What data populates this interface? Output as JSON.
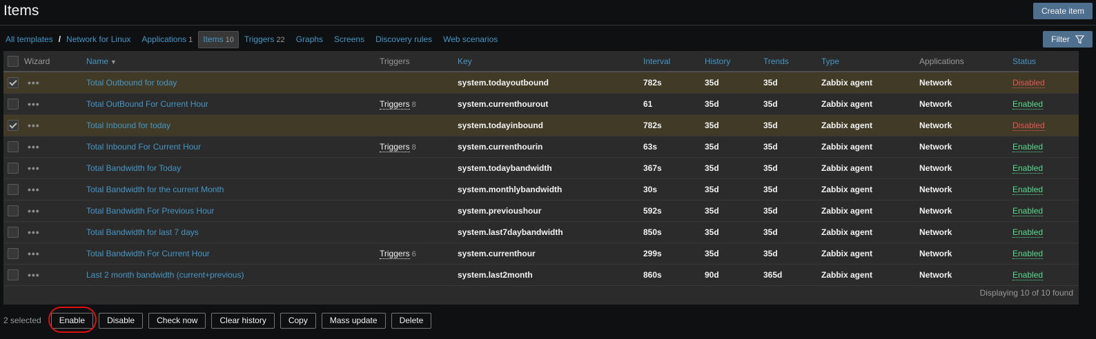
{
  "page": {
    "title": "Items",
    "create_button": "Create item"
  },
  "nav": {
    "breadcrumb_root": "All templates",
    "separator": "/",
    "template": "Network for Linux",
    "tabs": [
      {
        "label": "Applications",
        "count": "1"
      },
      {
        "label": "Items",
        "count": "10"
      },
      {
        "label": "Triggers",
        "count": "22"
      },
      {
        "label": "Graphs",
        "count": ""
      },
      {
        "label": "Screens",
        "count": ""
      },
      {
        "label": "Discovery rules",
        "count": ""
      },
      {
        "label": "Web scenarios",
        "count": ""
      }
    ],
    "active_tab": "Items"
  },
  "filter": {
    "label": "Filter",
    "icon": "funnel-icon"
  },
  "table": {
    "headers": {
      "wizard": "Wizard",
      "name": "Name",
      "triggers": "Triggers",
      "key": "Key",
      "interval": "Interval",
      "history": "History",
      "trends": "Trends",
      "type": "Type",
      "applications": "Applications",
      "status": "Status"
    },
    "sort_column": "Name",
    "rows": [
      {
        "selected": true,
        "name": "Total Outbound for today",
        "triggers_label": "",
        "triggers_count": "",
        "key": "system.todayoutbound",
        "interval": "782s",
        "history": "35d",
        "trends": "35d",
        "type": "Zabbix agent",
        "applications": "Network",
        "status": "Disabled"
      },
      {
        "selected": false,
        "name": "Total OutBound For Current Hour",
        "triggers_label": "Triggers",
        "triggers_count": "8",
        "key": "system.currenthourout",
        "interval": "61",
        "history": "35d",
        "trends": "35d",
        "type": "Zabbix agent",
        "applications": "Network",
        "status": "Enabled"
      },
      {
        "selected": true,
        "name": "Total Inbound for today",
        "triggers_label": "",
        "triggers_count": "",
        "key": "system.todayinbound",
        "interval": "782s",
        "history": "35d",
        "trends": "35d",
        "type": "Zabbix agent",
        "applications": "Network",
        "status": "Disabled"
      },
      {
        "selected": false,
        "name": "Total Inbound For Current Hour",
        "triggers_label": "Triggers",
        "triggers_count": "8",
        "key": "system.currenthourin",
        "interval": "63s",
        "history": "35d",
        "trends": "35d",
        "type": "Zabbix agent",
        "applications": "Network",
        "status": "Enabled"
      },
      {
        "selected": false,
        "name": "Total Bandwidth for Today",
        "triggers_label": "",
        "triggers_count": "",
        "key": "system.todaybandwidth",
        "interval": "367s",
        "history": "35d",
        "trends": "35d",
        "type": "Zabbix agent",
        "applications": "Network",
        "status": "Enabled"
      },
      {
        "selected": false,
        "name": "Total Bandwidth for the current Month",
        "triggers_label": "",
        "triggers_count": "",
        "key": "system.monthlybandwidth",
        "interval": "30s",
        "history": "35d",
        "trends": "35d",
        "type": "Zabbix agent",
        "applications": "Network",
        "status": "Enabled"
      },
      {
        "selected": false,
        "name": "Total Bandwidth For Previous Hour",
        "triggers_label": "",
        "triggers_count": "",
        "key": "system.previoushour",
        "interval": "592s",
        "history": "35d",
        "trends": "35d",
        "type": "Zabbix agent",
        "applications": "Network",
        "status": "Enabled"
      },
      {
        "selected": false,
        "name": "Total Bandwidth for last 7 days",
        "triggers_label": "",
        "triggers_count": "",
        "key": "system.last7daybandwidth",
        "interval": "850s",
        "history": "35d",
        "trends": "35d",
        "type": "Zabbix agent",
        "applications": "Network",
        "status": "Enabled"
      },
      {
        "selected": false,
        "name": "Total Bandwidth For Current Hour",
        "triggers_label": "Triggers",
        "triggers_count": "6",
        "key": "system.currenthour",
        "interval": "299s",
        "history": "35d",
        "trends": "35d",
        "type": "Zabbix agent",
        "applications": "Network",
        "status": "Enabled"
      },
      {
        "selected": false,
        "name": "Last 2 month bandwidth (current+previous)",
        "triggers_label": "",
        "triggers_count": "",
        "key": "system.last2month",
        "interval": "860s",
        "history": "90d",
        "trends": "365d",
        "type": "Zabbix agent",
        "applications": "Network",
        "status": "Enabled"
      }
    ],
    "footer": "Displaying 10 of 10 found"
  },
  "actions": {
    "selected_text": "2 selected",
    "buttons": [
      "Enable",
      "Disable",
      "Check now",
      "Clear history",
      "Copy",
      "Mass update",
      "Delete"
    ]
  },
  "colors": {
    "accent_link": "#4796c4",
    "enabled": "#59db8f",
    "disabled": "#e45959",
    "selected_row": "#403a26",
    "annotation": "#e01010"
  }
}
